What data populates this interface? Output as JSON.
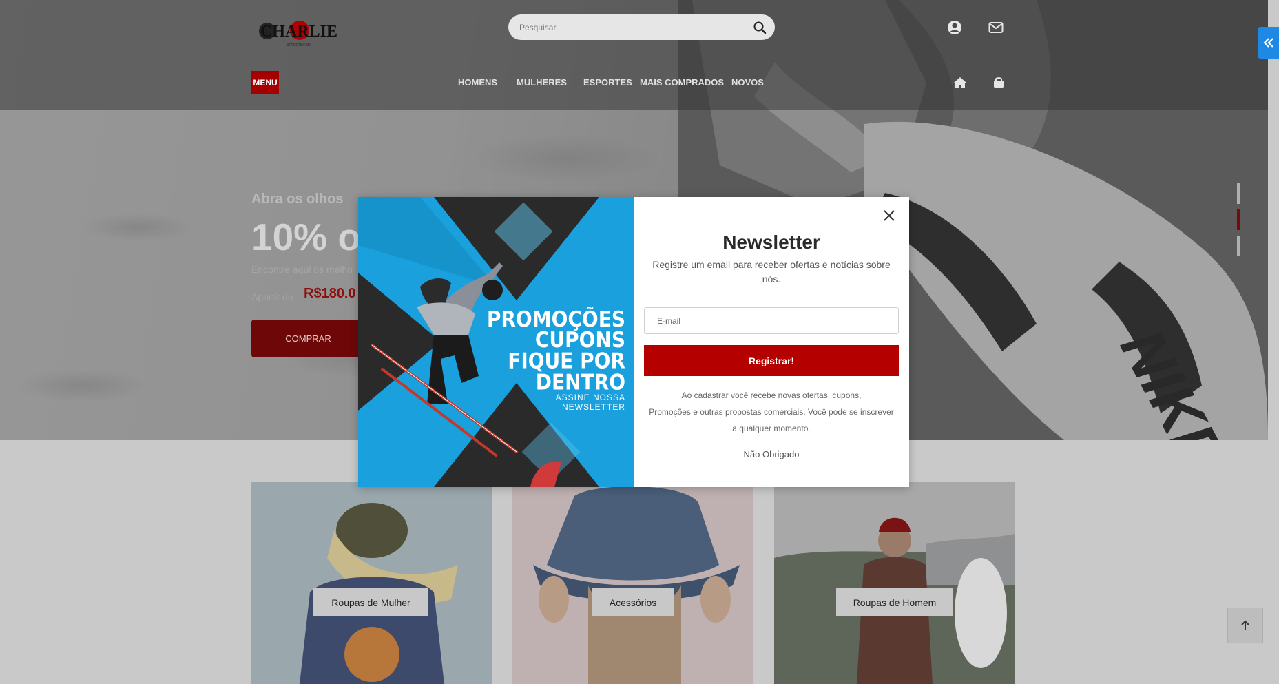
{
  "header": {
    "logo_text": "CHARLIE",
    "logo_sub": "STREETWEAR",
    "search_placeholder": "Pesquisar",
    "menu_label": "MENU",
    "nav": [
      {
        "label": "HOMENS"
      },
      {
        "label": "MULHERES"
      },
      {
        "label": "ESPORTES"
      },
      {
        "label": "MAIS COMPRADOS"
      },
      {
        "label": "NOVOS"
      }
    ],
    "icons": [
      "user-icon",
      "mail-icon",
      "home-icon",
      "shopping-bag-icon",
      "search-icon",
      "double-chevron-left-icon"
    ]
  },
  "hero": {
    "kicker": "Abra os olhos",
    "title": "10% o",
    "subtitle": "Encontre aqui os melho",
    "from_label": "Apartir de",
    "price": "R$180.0",
    "cta": "COMPRAR",
    "brand_mark": "NIKE"
  },
  "modal": {
    "promo": {
      "line1": "PROMOÇÕES",
      "line2": "CUPONS",
      "line3": "FIQUE POR",
      "line4": "DENTRO",
      "sub1": "ASSINE NOSSA",
      "sub2": "NEWSLETTER"
    },
    "title": "Newsletter",
    "description": "Registre um email para receber ofertas e notícias sobre nós.",
    "email_placeholder": "E-mail",
    "register_label": "Registrar!",
    "legal_line1": "Ao cadastrar você recebe novas ofertas, cupons,",
    "legal_line2": "Promoções e outras propostas comerciais. Você pode se inscrever",
    "legal_line3": "a qualquer momento.",
    "no_thanks": "Não Obrigado"
  },
  "categories": [
    {
      "label": "Roupas de Mulher"
    },
    {
      "label": "Acessórios"
    },
    {
      "label": "Roupas de Homem"
    }
  ],
  "colors": {
    "brand_red": "#b50000",
    "accent_blue": "#1e88e5",
    "promo_blue": "#1aa0dc"
  }
}
